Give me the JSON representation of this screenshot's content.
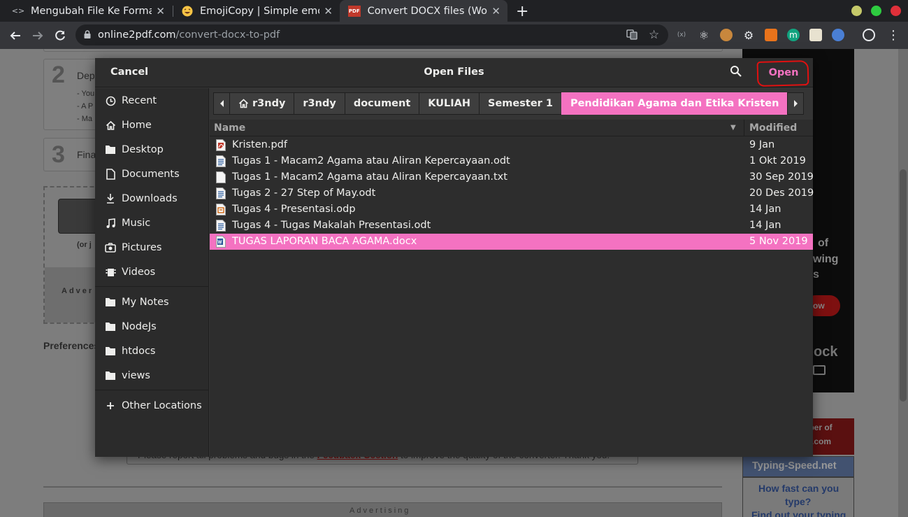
{
  "browser": {
    "tabs": [
      {
        "title": "Mengubah File Ke Format",
        "favicon": "code-icon",
        "active": false
      },
      {
        "title": "EmojiCopy | Simple emoji",
        "favicon": "emoji-icon",
        "active": false
      },
      {
        "title": "Convert DOCX files (Word",
        "favicon": "pdf-icon",
        "active": true
      }
    ],
    "pdf_badge": "PDF",
    "url_host": "online2pdf.com",
    "url_path": "/convert-docx-to-pdf"
  },
  "dialog": {
    "title": "Open Files",
    "cancel_label": "Cancel",
    "open_label": "Open",
    "accent_color": "#f472c1",
    "sidebar": [
      {
        "label": "Recent",
        "icon": "clock-icon"
      },
      {
        "label": "Home",
        "icon": "home-icon"
      },
      {
        "label": "Desktop",
        "icon": "folder-icon"
      },
      {
        "label": "Documents",
        "icon": "document-icon"
      },
      {
        "label": "Downloads",
        "icon": "download-icon"
      },
      {
        "label": "Music",
        "icon": "music-icon"
      },
      {
        "label": "Pictures",
        "icon": "camera-icon"
      },
      {
        "label": "Videos",
        "icon": "video-icon"
      },
      {
        "label": "My Notes",
        "icon": "folder-icon"
      },
      {
        "label": "NodeJs",
        "icon": "folder-icon"
      },
      {
        "label": "htdocs",
        "icon": "folder-icon"
      },
      {
        "label": "views",
        "icon": "folder-icon"
      },
      {
        "label": "Other Locations",
        "icon": "plus-icon"
      }
    ],
    "breadcrumbs": [
      "r3ndy",
      "r3ndy",
      "document",
      "KULIAH",
      "Semester 1",
      "Pendidikan Agama dan Etika Kristen"
    ],
    "columns": {
      "name": "Name",
      "modified": "Modified"
    },
    "files": [
      {
        "name": "Kristen.pdf",
        "modified": "9 Jan",
        "type": "pdf"
      },
      {
        "name": "Tugas 1 - Macam2 Agama atau Aliran Kepercayaan.odt",
        "modified": "1 Okt 2019",
        "type": "odt"
      },
      {
        "name": "Tugas 1 - Macam2 Agama atau Aliran Kepercayaan.txt",
        "modified": "30 Sep 2019",
        "type": "txt"
      },
      {
        "name": "Tugas 2 - 27 Step of May.odt",
        "modified": "20 Des 2019",
        "type": "odt"
      },
      {
        "name": "Tugas 4  - Presentasi.odp",
        "modified": "14 Jan",
        "type": "odp"
      },
      {
        "name": "Tugas 4 - Tugas Makalah Presentasi.odt",
        "modified": "14 Jan",
        "type": "odt"
      },
      {
        "name": "TUGAS LAPORAN BACA AGAMA.docx",
        "modified": "5 Nov 2019",
        "type": "docx",
        "selected": true
      }
    ]
  },
  "background_page": {
    "step2_num": "2",
    "step2_title": "Dep",
    "step2_lines": [
      "- You",
      "- A P",
      "- Ma"
    ],
    "step3_num": "3",
    "step3_title": "Fina",
    "or_text": "(or j",
    "advert_text": "Adver",
    "preferences_label": "Preferences",
    "feedback_pre": "Please report all problems and bugs in the",
    "feedback_link": "Feedback-Section",
    "feedback_post": "to improve the quality of the converter. Thank you!",
    "advertising_label": "Advertising",
    "ad_text_1": "of",
    "ad_text_2": "wing",
    "ad_text_3": "s",
    "ad_button": "ow",
    "ad_brand": "ock",
    "dev_line_1": "oper of",
    "dev_line_2": "f.com",
    "typing_title": "Typing-Speed.net",
    "typing_line_1": "How fast can you",
    "typing_line_2": "type?",
    "typing_line_3": "Find out your typing"
  }
}
